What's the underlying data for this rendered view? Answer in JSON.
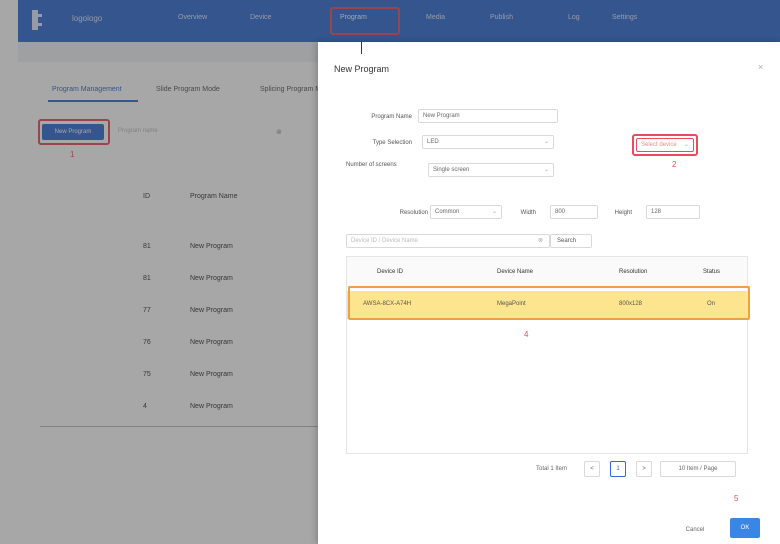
{
  "topbar": {
    "app_name": "logologo",
    "nav": [
      "Overview",
      "Device",
      "Program",
      "Media",
      "Publish",
      "Log",
      "Settings"
    ],
    "active_nav_index": 2
  },
  "background": {
    "subtabs": [
      "Program Management",
      "Slide Program Mode",
      "Splicing Program Mode"
    ],
    "new_program_button": "New Program",
    "search_placeholder": "Program name",
    "step1_label": "1",
    "table_headers": [
      "ID",
      "Program Name"
    ],
    "rows": [
      {
        "id": "81",
        "name": "New Program"
      },
      {
        "id": "81",
        "name": "New Program"
      },
      {
        "id": "77",
        "name": "New Program"
      },
      {
        "id": "76",
        "name": "New Program"
      },
      {
        "id": "75",
        "name": "New Program"
      },
      {
        "id": "4",
        "name": "New Program"
      }
    ]
  },
  "dialog": {
    "title": "New Program",
    "close_icon": "×",
    "program_name_label": "Program Name",
    "program_name_value": "New Program",
    "type_label": "Type Selection",
    "type_value": "LED",
    "screens_label": "Number of screens",
    "screens_value": "Single screen",
    "resolution_label": "Resolution",
    "resolution_value": "Common",
    "width_label": "Width",
    "width_value": "800",
    "height_label": "Height",
    "height_value": "128",
    "select_device_button": "Select device",
    "step2_label": "2",
    "search_placeholder": "Device ID / Device Name",
    "search_button": "Search",
    "device_table_headers": [
      "Device ID",
      "Device Name",
      "Resolution",
      "Status"
    ],
    "device_row": {
      "id": "AWSA-8CX-A74H",
      "name": "MegaPoint",
      "resolution": "800x128",
      "status": "On"
    },
    "step4_label": "4",
    "pagination": {
      "total": "Total 1 Item",
      "prev": "<",
      "current_page": "1",
      "next": ">",
      "page_size": "10 Item / Page"
    },
    "step5_label": "5",
    "cancel_button": "Cancel",
    "ok_button": "OK"
  },
  "colors": {
    "primary": "#2f6bd0",
    "highlight_red": "#e74c5c",
    "row_highlight": "#fde58f",
    "row_border": "#f0a040"
  }
}
